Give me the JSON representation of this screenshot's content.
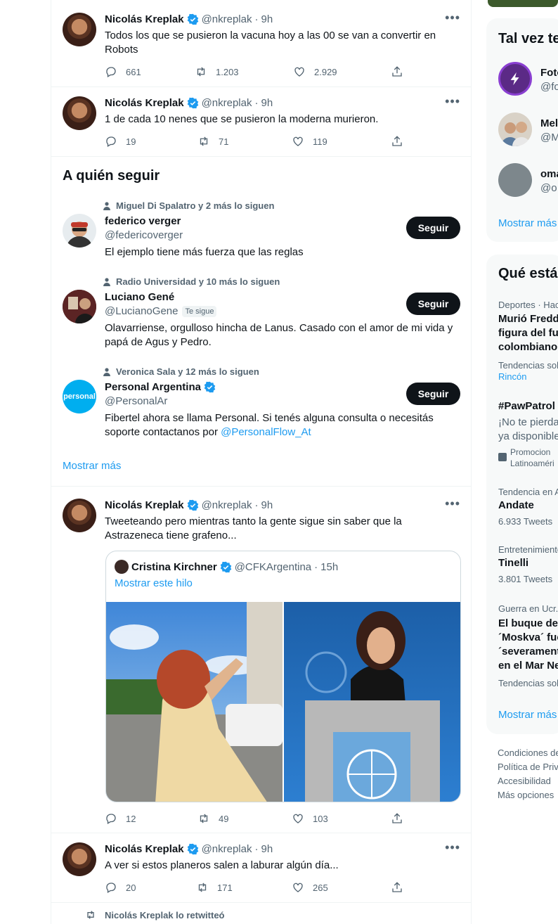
{
  "tweets": [
    {
      "name": "Nicolás Kreplak",
      "handle": "@nkreplak",
      "time": "9h",
      "text": "Todos los que se pusieron la vacuna hoy a las 00 se van a convertir en Robots",
      "replies": "661",
      "retweets": "1.203",
      "likes": "2.929"
    },
    {
      "name": "Nicolás Kreplak",
      "handle": "@nkreplak",
      "time": "9h",
      "text": "1 de cada 10 nenes que se pusieron la moderna murieron.",
      "replies": "19",
      "retweets": "71",
      "likes": "119"
    },
    {
      "name": "Nicolás Kreplak",
      "handle": "@nkreplak",
      "time": "9h",
      "text": "Tweeteando pero mientras tanto la gente sigue sin saber que la Astrazeneca tiene grafeno...",
      "replies": "12",
      "retweets": "49",
      "likes": "103"
    },
    {
      "name": "Nicolás Kreplak",
      "handle": "@nkreplak",
      "time": "9h",
      "text": "A ver si estos planeros salen a laburar algún día...",
      "replies": "20",
      "retweets": "171",
      "likes": "265"
    }
  ],
  "quote": {
    "name": "Cristina Kirchner",
    "handle": "@CFKArgentina",
    "time": "15h",
    "show_thread": "Mostrar este hilo"
  },
  "who_to_follow": {
    "title": "A quién seguir",
    "show_more": "Mostrar más",
    "follow_label": "Seguir",
    "users": [
      {
        "social": "Miguel Di Spalatro y 2 más lo siguen",
        "name": "federico verger",
        "handle": "@federicoverger",
        "bio": "El ejemplo tiene más fuerza que las reglas",
        "follows_you": ""
      },
      {
        "social": "Radio Universidad y 10 más lo siguen",
        "name": "Luciano Gené",
        "handle": "@LucianoGene",
        "bio": "Olavarriense, orgulloso hincha de Lanus. Casado con el amor de mi vida y papá de Agus y Pedro.",
        "follows_you": "Te sigue"
      },
      {
        "social": "Veronica Sala y 12 más lo siguen",
        "name": "Personal Argentina",
        "handle": "@PersonalAr",
        "bio": "Fibertel ahora se llama Personal. Si tenés alguna consulta o necesitás soporte contactanos por ",
        "bio_link": "@PersonalFlow_At",
        "avatar_text": "personal"
      }
    ]
  },
  "retweet_note": "Nicolás Kreplak lo retwitteó",
  "sidebar": {
    "maybe_title": "Tal vez te",
    "maybe_users": [
      {
        "name": "Foto",
        "handle": "@fo"
      },
      {
        "name": "Mel",
        "handle": "@M"
      },
      {
        "name": "oma",
        "handle": "@o"
      }
    ],
    "show_more": "Mostrar más",
    "trends_title": "Qué está",
    "trends": [
      {
        "context": "Deportes · Hac",
        "title": [
          "Murió Fredd",
          "figura del fu",
          "colombiano"
        ],
        "meta": "Tendencias sob",
        "meta_link": "Rincón"
      },
      {
        "context": "",
        "title": [
          "#PawPatrol"
        ],
        "desc": [
          "¡No te pierda",
          "ya disponible"
        ],
        "promo": [
          "Promocion",
          "Latinoaméri"
        ]
      },
      {
        "context": "Tendencia en A",
        "title": [
          "Andate"
        ],
        "meta": "6.933 Tweets"
      },
      {
        "context": "Entretenimiento",
        "title": [
          "Tinelli"
        ],
        "meta": "3.801 Tweets"
      },
      {
        "context": "Guerra en Ucr.",
        "title": [
          "El buque de",
          "´Moskva´ fue",
          "´severament",
          "en el Mar Ne"
        ],
        "meta": "Tendencias sob"
      }
    ],
    "trends_show_more": "Mostrar más",
    "footer": [
      "Condiciones de",
      "Política de Priv",
      "Accesibilidad",
      "Más opciones"
    ]
  },
  "colors": {
    "accent": "#1d9bf0",
    "button": "#0f1419",
    "secondary_text": "#536471"
  }
}
